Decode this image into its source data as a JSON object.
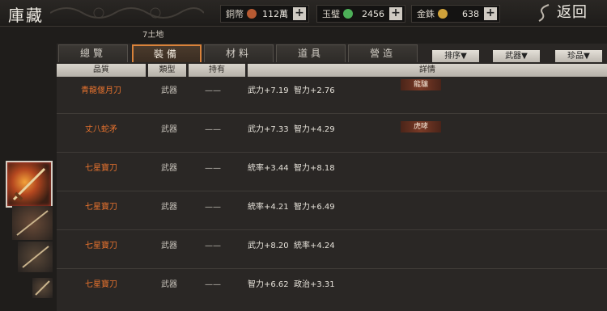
{
  "title": "庫藏",
  "currencies": [
    {
      "label": "銅幣",
      "value": "112萬",
      "color": "#b75a32"
    },
    {
      "label": "玉璧",
      "value": "2456",
      "color": "#4caf58"
    },
    {
      "label": "金銖",
      "value": "638",
      "color": "#d0a23a"
    }
  ],
  "add_label": "+",
  "back_label": "返回",
  "location": "7土地",
  "tabs": [
    "總覽",
    "裝備",
    "材料",
    "道具",
    "營造"
  ],
  "filters": [
    "排序▼",
    "武器▼",
    "珍品▼"
  ],
  "columns": [
    "品質",
    "類型",
    "持有",
    "詳情"
  ],
  "rows": [
    {
      "name": "青龍偃月刀",
      "type": "武器",
      "owner": "——",
      "stats": "武力+7.19  智力+2.76",
      "tag": "龍驤"
    },
    {
      "name": "丈八蛇矛",
      "type": "武器",
      "owner": "——",
      "stats": "武力+7.33  智力+4.29",
      "tag": "虎哮"
    },
    {
      "name": "七星寶刀",
      "type": "武器",
      "owner": "——",
      "stats": "統率+3.44  智力+8.18",
      "tag": ""
    },
    {
      "name": "七星寶刀",
      "type": "武器",
      "owner": "——",
      "stats": "統率+4.21  智力+6.49",
      "tag": ""
    },
    {
      "name": "七星寶刀",
      "type": "武器",
      "owner": "——",
      "stats": "武力+8.20  統率+4.24",
      "tag": ""
    },
    {
      "name": "七星寶刀",
      "type": "武器",
      "owner": "——",
      "stats": "智力+6.62  政治+3.31",
      "tag": ""
    }
  ]
}
